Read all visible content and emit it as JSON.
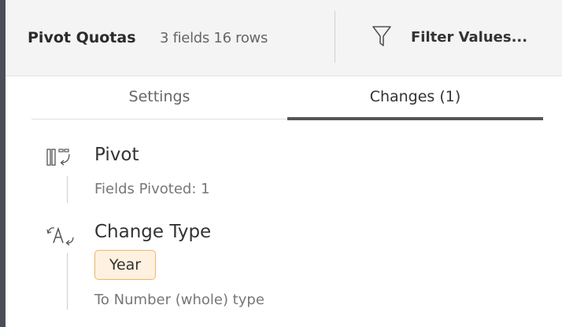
{
  "header": {
    "step_name": "Pivot Quotas",
    "step_meta": "3 fields  16 rows",
    "filter_label": "Filter Values..."
  },
  "tabs": [
    {
      "label": "Settings",
      "selected": false
    },
    {
      "label": "Changes (1)",
      "selected": true
    }
  ],
  "changes": [
    {
      "icon": "pivot-icon",
      "title": "Pivot",
      "detail": "Fields Pivoted: 1"
    },
    {
      "icon": "change-type-icon",
      "title": "Change Type",
      "field": "Year",
      "detail": "To Number (whole) type"
    }
  ],
  "colors": {
    "left_border": "#4a4f55",
    "header_bg": "#f4f4f4",
    "tab_indicator": "#555555",
    "chip_border": "#f0b46a",
    "chip_bg": "#fff1df"
  }
}
